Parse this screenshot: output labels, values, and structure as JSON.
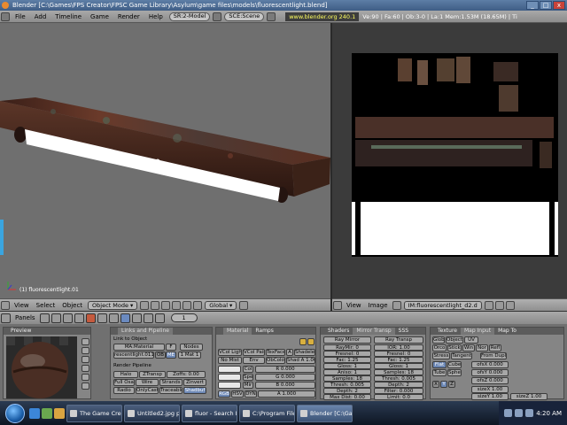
{
  "window": {
    "title": "Blender [C:\\Games\\FPS Creator\\FPSC Game Library\\Asylum\\game files\\models\\fluorescentlight.blend]",
    "controls": [
      "_",
      "□",
      "x"
    ]
  },
  "info_header": {
    "menus": [
      "File",
      "Add",
      "Timeline",
      "Game",
      "Render",
      "Help"
    ],
    "screen": "SR:2-Model",
    "scene": "SCE:Scene",
    "site": "www.blender.org 240.1",
    "stats": "Ve:90 | Fa:60 | Ob:3-0 | La:1  Mem:1.53M (18.65M) | Ti"
  },
  "view3d": {
    "object_label": "(1) fluorescentlight.01",
    "header": {
      "menus": [
        "View",
        "Select",
        "Object"
      ],
      "mode": "Object Mode",
      "pivot": "Global"
    }
  },
  "image_editor": {
    "header": {
      "menus": [
        "View",
        "Image"
      ],
      "image_name": "IM:fluorescentlight_d2.d"
    }
  },
  "buttons_window": {
    "header": {
      "menus": [
        "Panels"
      ],
      "frame": "1"
    },
    "preview": {
      "title": "Preview"
    },
    "links": {
      "tabs": [
        "Links and Pipeline"
      ],
      "link_to_object": "Link to Object",
      "ma_material": "MA:Material",
      "f": "F",
      "nodes": "Nodes",
      "me_name": "rescentlight.011",
      "ob": "OB",
      "me": "ME",
      "mat_index": "1 Mat 1",
      "render_pipeline": "Render Pipeline",
      "rp_row1": [
        "Halo",
        "ZTransp",
        "Zoffs: 0.00"
      ],
      "rp_row2": [
        "Full Osa",
        "Wire",
        "Strands",
        "Zinvert"
      ],
      "rp_row3": [
        "Radio",
        "OnlyCast",
        "Traceable",
        "Shadbuf"
      ]
    },
    "material": {
      "tabs": [
        "Material",
        "Ramps"
      ],
      "row1": [
        "VCol Ligh",
        "VCol Pain",
        "TexFace",
        "A",
        "Shadeles"
      ],
      "row2": [
        "No Mist",
        "Env",
        "ObColor",
        "Shad A 1.00"
      ],
      "col_labels": [
        "Col",
        "Spe",
        "Mir"
      ],
      "rgb": [
        "R 0.000",
        "G 0.000",
        "B 0.000"
      ],
      "bottom": [
        "RGB",
        "HSV",
        "DYN",
        "A 1.000"
      ]
    },
    "shaders": {
      "tabs": [
        "Shaders",
        "Mirror Transp",
        "SSS"
      ],
      "ray_mirror": "Ray Mirror",
      "ray_transp": "Ray Transp",
      "left": [
        "RayMir: 0",
        "Fresnel: 0",
        "Fac: 1.25",
        "Gloss: 1",
        "Aniso: 1",
        "Samples: 18",
        "Thresh: 0.005",
        "Depth: 2",
        "Max Dist: 0.00"
      ],
      "right": [
        "IOR: 1.00",
        "Fresnel: 0",
        "Fac: 1.25",
        "Gloss: 1",
        "Samples: 18",
        "Thresh: 0.005",
        "Depth: 2",
        "Filter: 0.000",
        "Limit: 0.0"
      ]
    },
    "texture": {
      "tabs": [
        "Texture",
        "Map Input",
        "Map To"
      ],
      "row1": [
        "Glob",
        "Object",
        "UV"
      ],
      "row2": [
        "Orco",
        "Stick",
        "Win",
        "Nor",
        "Refl"
      ],
      "row3": [
        "Stress",
        "Tangent",
        "From Dupli"
      ],
      "row4": [
        "Flat",
        "Cube"
      ],
      "row5": [
        "Tube",
        "Sphe"
      ],
      "offsets": [
        "ofsX 0.000",
        "ofsY 0.000",
        "ofsZ 0.000"
      ],
      "xyz": [
        "X",
        "Y",
        "Z"
      ],
      "sizes": [
        "sizeX 1.00",
        "sizeY 1.00",
        "sizeZ 1.00"
      ]
    }
  },
  "taskbar": {
    "tasks": [
      "The Game Creator...",
      "Untitled2.jpg pict...",
      "fluor - Search Res...",
      "C:\\Program Files\\...",
      "Blender [C:\\Game..."
    ],
    "clock": "4:20 AM"
  },
  "colors": {
    "title_bar": "#4a6a94",
    "header_gray": "#9c9c9c",
    "viewport": "#6f6f6f",
    "site_text": "#ffff60"
  }
}
